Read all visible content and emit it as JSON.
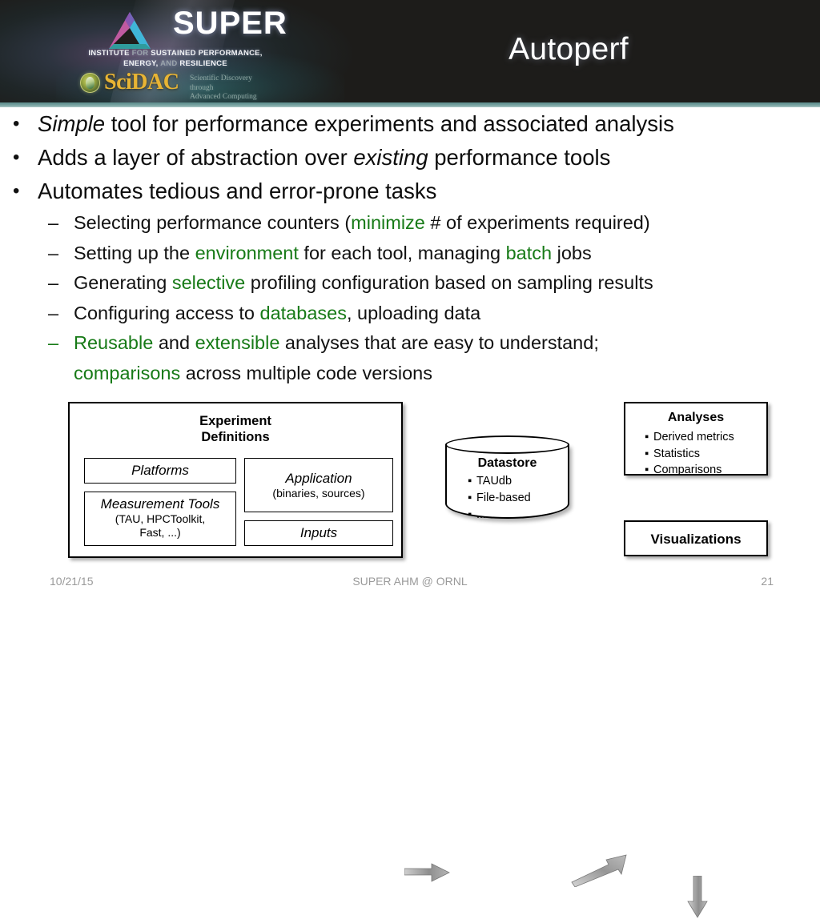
{
  "header": {
    "brand": {
      "name": "SUPER",
      "tagline_line1_a": "INSTITUTE",
      "tagline_line1_b": "FOR",
      "tagline_line1_c": "SUSTAINED PERFORMANCE,",
      "tagline_line2_a": "ENERGY,",
      "tagline_line2_b": "AND",
      "tagline_line2_c": "RESILIENCE",
      "scidac_name": "SciDAC",
      "scidac_sub_line1": "Scientific Discovery through",
      "scidac_sub_line2": "Advanced Computing"
    },
    "title": "Autoperf"
  },
  "bullets": {
    "level1": [
      {
        "parts": [
          {
            "text": "Simple",
            "style": "italic"
          },
          {
            "text": " tool for performance experiments and associated analysis",
            "style": "normal"
          }
        ]
      },
      {
        "parts": [
          {
            "text": "Adds a layer of abstraction over ",
            "style": "normal"
          },
          {
            "text": "existing",
            "style": "italic"
          },
          {
            "text": " performance tools",
            "style": "normal"
          }
        ]
      },
      {
        "parts": [
          {
            "text": "Automates tedious and error-prone tasks",
            "style": "normal"
          }
        ]
      }
    ],
    "level2": [
      {
        "dash_color": "black",
        "parts": [
          {
            "text": "Selecting performance counters (",
            "style": "normal"
          },
          {
            "text": "minimize",
            "style": "green"
          },
          {
            "text": " # of experiments required)",
            "style": "normal"
          }
        ]
      },
      {
        "dash_color": "black",
        "parts": [
          {
            "text": "Setting up the ",
            "style": "normal"
          },
          {
            "text": "environment",
            "style": "green"
          },
          {
            "text": " for each tool, managing ",
            "style": "normal"
          },
          {
            "text": "batch",
            "style": "green"
          },
          {
            "text": " jobs",
            "style": "normal"
          }
        ]
      },
      {
        "dash_color": "black",
        "parts": [
          {
            "text": "Generating ",
            "style": "normal"
          },
          {
            "text": "selective",
            "style": "green"
          },
          {
            "text": " profiling configuration based on sampling results",
            "style": "normal"
          }
        ]
      },
      {
        "dash_color": "black",
        "parts": [
          {
            "text": "Configuring access to ",
            "style": "normal"
          },
          {
            "text": "databases",
            "style": "green"
          },
          {
            "text": ", uploading data",
            "style": "normal"
          }
        ]
      },
      {
        "dash_color": "green",
        "parts": [
          {
            "text": "Reusable",
            "style": "green"
          },
          {
            "text": " and ",
            "style": "normal"
          },
          {
            "text": "extensible",
            "style": "green"
          },
          {
            "text": " analyses that are easy to understand;",
            "style": "normal"
          },
          {
            "text": "\n",
            "style": "break"
          },
          {
            "text": "comparisons",
            "style": "green"
          },
          {
            "text": " across multiple code versions",
            "style": "normal"
          }
        ]
      }
    ],
    "dash_glyph": "–",
    "dot_glyph": "•",
    "accent_green": "#177a17"
  },
  "diagram": {
    "experiment_definitions": {
      "title_line1": "Experiment",
      "title_line2": "Definitions",
      "platforms": "Platforms",
      "measurement_tools_title": "Measurement Tools",
      "measurement_tools_sub_line1": "(TAU, HPCToolkit,",
      "measurement_tools_sub_line2": "Fast, ...)",
      "application_title": "Application",
      "application_sub": "(binaries, sources)",
      "inputs": "Inputs"
    },
    "datastore": {
      "title": "Datastore",
      "items": [
        "TAUdb",
        "File-based",
        "..."
      ],
      "bullet_glyph": "▪"
    },
    "analyses": {
      "title": "Analyses",
      "items": [
        "Derived metrics",
        "Statistics",
        "Comparisons"
      ],
      "bullet_glyph": "▪"
    },
    "visualizations": {
      "title": "Visualizations"
    }
  },
  "footer": {
    "date": "10/21/15",
    "center": "SUPER AHM @ ORNL",
    "page": "21"
  }
}
